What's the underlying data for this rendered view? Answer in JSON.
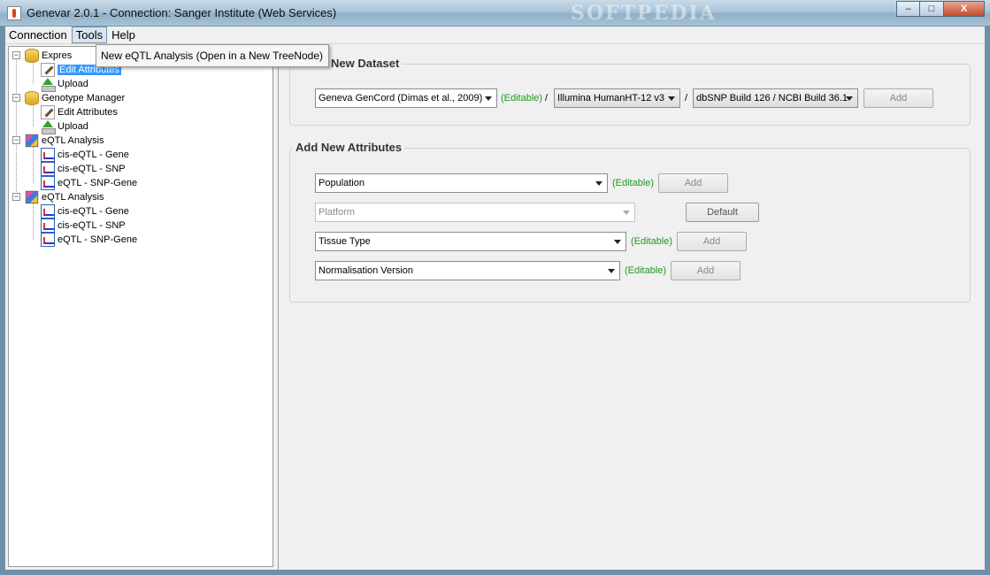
{
  "window": {
    "title": "Genevar 2.0.1 - Connection: Sanger Institute (Web Services)",
    "watermark": "SOFTPEDIA",
    "minimize_glyph": "–",
    "maximize_glyph": "□",
    "close_glyph": "X"
  },
  "menubar": {
    "items": [
      {
        "label": "Connection"
      },
      {
        "label": "Tools"
      },
      {
        "label": "Help"
      }
    ]
  },
  "popup": {
    "item": "New eQTL Analysis (Open in a New TreeNode)"
  },
  "tree": {
    "nodes": [
      {
        "label": "Expres",
        "icon": "database-icon",
        "level": 0
      },
      {
        "label": "Edit Attributes",
        "icon": "edit-icon",
        "level": 1,
        "selected": true
      },
      {
        "label": "Upload",
        "icon": "upload-icon",
        "level": 1
      },
      {
        "label": "Genotype Manager",
        "icon": "database-icon",
        "level": 0
      },
      {
        "label": "Edit Attributes",
        "icon": "edit-icon",
        "level": 1
      },
      {
        "label": "Upload",
        "icon": "upload-icon",
        "level": 1
      },
      {
        "label": "eQTL Analysis",
        "icon": "cube-icon",
        "level": 0
      },
      {
        "label": "cis-eQTL - Gene",
        "icon": "chart-icon",
        "level": 1
      },
      {
        "label": "cis-eQTL - SNP",
        "icon": "chart-icon",
        "level": 1
      },
      {
        "label": "eQTL - SNP-Gene",
        "icon": "chart-icon",
        "level": 1
      },
      {
        "label": "eQTL Analysis",
        "icon": "cube-icon",
        "level": 0
      },
      {
        "label": "cis-eQTL - Gene",
        "icon": "chart-icon",
        "level": 1
      },
      {
        "label": "cis-eQTL - SNP",
        "icon": "chart-icon",
        "level": 1
      },
      {
        "label": "eQTL - SNP-Gene",
        "icon": "chart-icon",
        "level": 1
      }
    ]
  },
  "new_dataset": {
    "title": "New Dataset",
    "dataset_combo": "Geneva GenCord (Dimas et al., 2009)",
    "editable_label": "(Editable)",
    "separator": "/",
    "platform_combo": "Illumina HumanHT-12 v3",
    "build_combo": "dbSNP Build 126 / NCBI Build 36.1",
    "add_label": "Add"
  },
  "attributes": {
    "title": "Add New Attributes",
    "population": {
      "value": "Population",
      "editable": "(Editable)",
      "button": "Add"
    },
    "platform": {
      "value": "Platform",
      "button": "Default"
    },
    "tissue": {
      "value": "Tissue Type",
      "editable": "(Editable)",
      "button": "Add"
    },
    "normalisation": {
      "value": "Normalisation Version",
      "editable": "(Editable)",
      "button": "Add"
    }
  }
}
